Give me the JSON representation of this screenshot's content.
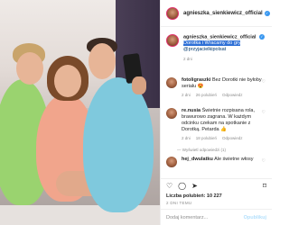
{
  "post": {
    "username": "agnieszka_sienkiewicz_official",
    "caption_user": "agnieszka_sienkiewicz_official",
    "caption_highlight": "Dorotka i Wracamy do gry",
    "caption_mention": "@przyjacielkipolsat",
    "caption_age": "2 dni"
  },
  "comments": [
    {
      "user": "fotoligraszki",
      "text": "Bez Dorotki nie byłoby serialu 😍",
      "age": "2 dni",
      "likes": "26 polubień",
      "reply": "Odpowiedz"
    },
    {
      "user": "re.nusia",
      "text": "Świetnie rozpisana rola, brawurowo zagrana. W każdym odcinku czekam na spotkanie z Dorotką. Petarda 👍",
      "age": "2 dni",
      "likes": "18 polubień",
      "reply": "Odpowiedz"
    },
    {
      "user": "hej_dwulatku",
      "text": "Ale świetne włosy",
      "age": "",
      "likes": "",
      "reply": ""
    }
  ],
  "replies_toggle": "— Wyświetl odpowiedzi (1)",
  "likes_label": "Liczba polubień: 10 227",
  "post_date": "2 DNI TEMU",
  "add_comment_placeholder": "Dodaj komentarz...",
  "publish_label": "Opublikuj",
  "icons": {
    "like": "heart-icon",
    "comment": "comment-icon",
    "share": "share-icon",
    "save": "bookmark-icon"
  },
  "colors": {
    "highlight": "#2d6fd6",
    "verified": "#3897f0",
    "mention": "#00376b",
    "muted": "#8e8e8e"
  }
}
